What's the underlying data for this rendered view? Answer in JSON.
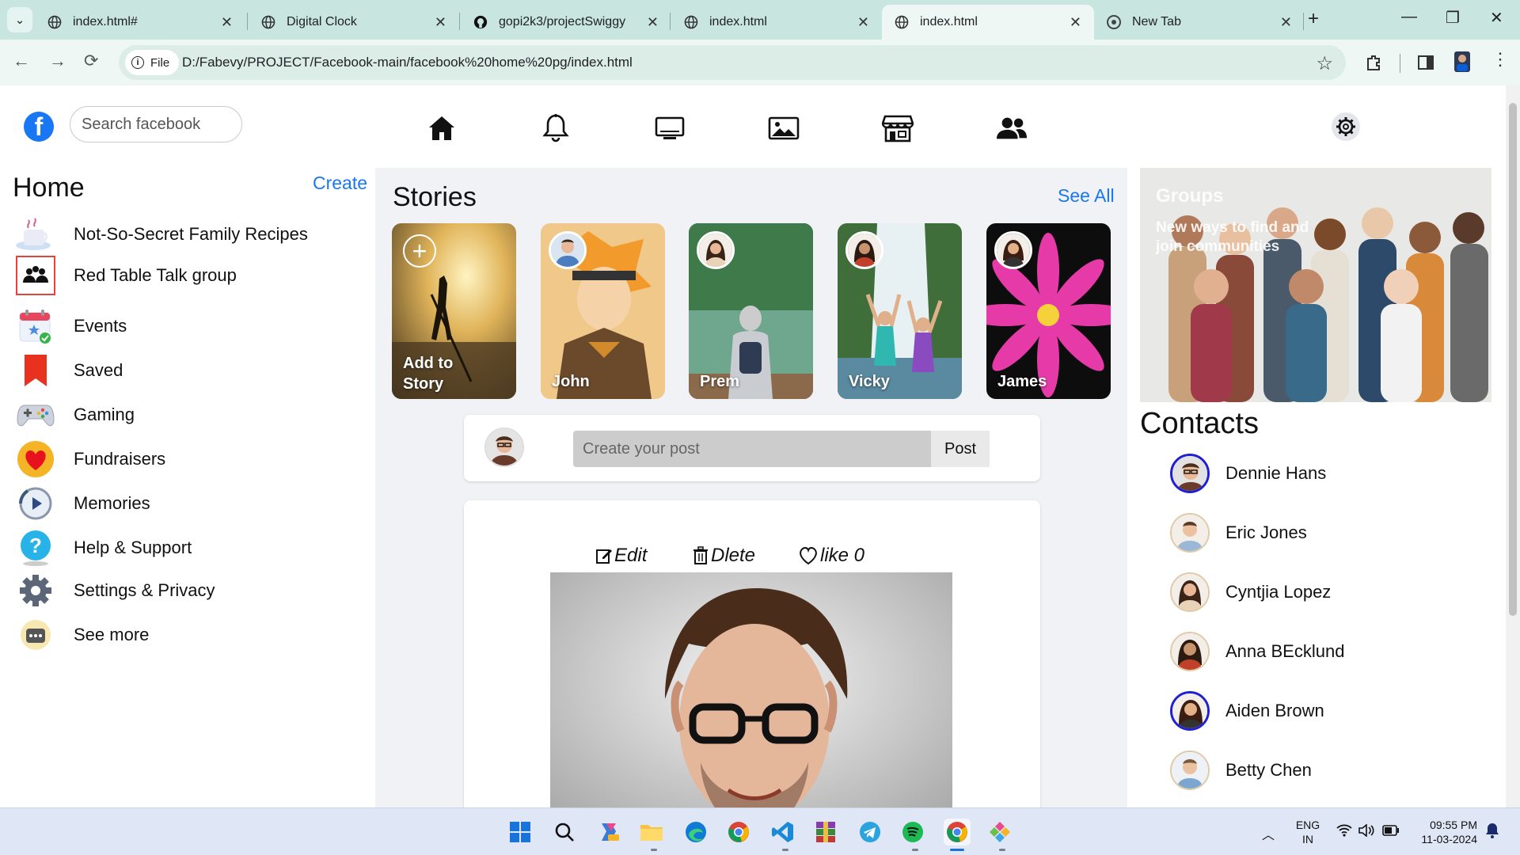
{
  "browser": {
    "tabs": [
      {
        "title": "index.html#"
      },
      {
        "title": "Digital Clock"
      },
      {
        "title": "gopi2k3/projectSwiggy"
      },
      {
        "title": "index.html"
      },
      {
        "title": "index.html",
        "active": true
      },
      {
        "title": "New Tab"
      }
    ],
    "file_chip": "File",
    "url": "D:/Fabevy/PROJECT/Facebook-main/facebook%20home%20pg/index.html"
  },
  "header": {
    "search_placeholder": "Search facebook",
    "nav_icons": [
      "home-icon",
      "bell-icon",
      "monitor-icon",
      "image-icon",
      "store-icon",
      "people-icon"
    ]
  },
  "sidebar": {
    "title": "Home",
    "create_label": "Create",
    "items": [
      {
        "label": "Not-So-Secret Family Recipes",
        "icon": "recipes-icon"
      },
      {
        "label": "Red Table Talk group",
        "icon": "group-icon"
      },
      {
        "label": "Events",
        "icon": "calendar-icon"
      },
      {
        "label": "Saved",
        "icon": "bookmark-icon"
      },
      {
        "label": "Gaming",
        "icon": "gamepad-icon"
      },
      {
        "label": "Fundraisers",
        "icon": "heart-icon"
      },
      {
        "label": "Memories",
        "icon": "memories-icon"
      },
      {
        "label": "Help & Support",
        "icon": "help-icon"
      },
      {
        "label": "Settings & Privacy",
        "icon": "settings-icon"
      },
      {
        "label": "See more",
        "icon": "more-icon"
      }
    ]
  },
  "stories": {
    "title": "Stories",
    "see_all": "See All",
    "add_label": "Add to Story",
    "items": [
      {
        "name": "John"
      },
      {
        "name": "Prem"
      },
      {
        "name": "Vicky"
      },
      {
        "name": "James"
      }
    ]
  },
  "composer": {
    "placeholder": "Create your post",
    "post_label": "Post"
  },
  "post": {
    "edit_label": "Edit",
    "delete_label": "Dlete",
    "like_label": "like 0"
  },
  "groups": {
    "title": "Groups",
    "description": "New ways to find and join communities"
  },
  "contacts": {
    "title": "Contacts",
    "items": [
      {
        "name": "Dennie Hans"
      },
      {
        "name": "Eric Jones"
      },
      {
        "name": "Cyntjia Lopez"
      },
      {
        "name": "Anna BEcklund"
      },
      {
        "name": "Aiden Brown"
      },
      {
        "name": "Betty Chen"
      }
    ]
  },
  "taskbar": {
    "lang": "ENG",
    "region": "IN",
    "time": "09:55 PM",
    "date": "11-03-2024"
  },
  "colors": {
    "facebook_blue": "#1877f2",
    "tabbar_bg": "#c8e6df",
    "page_bg": "#f0f2f5"
  }
}
